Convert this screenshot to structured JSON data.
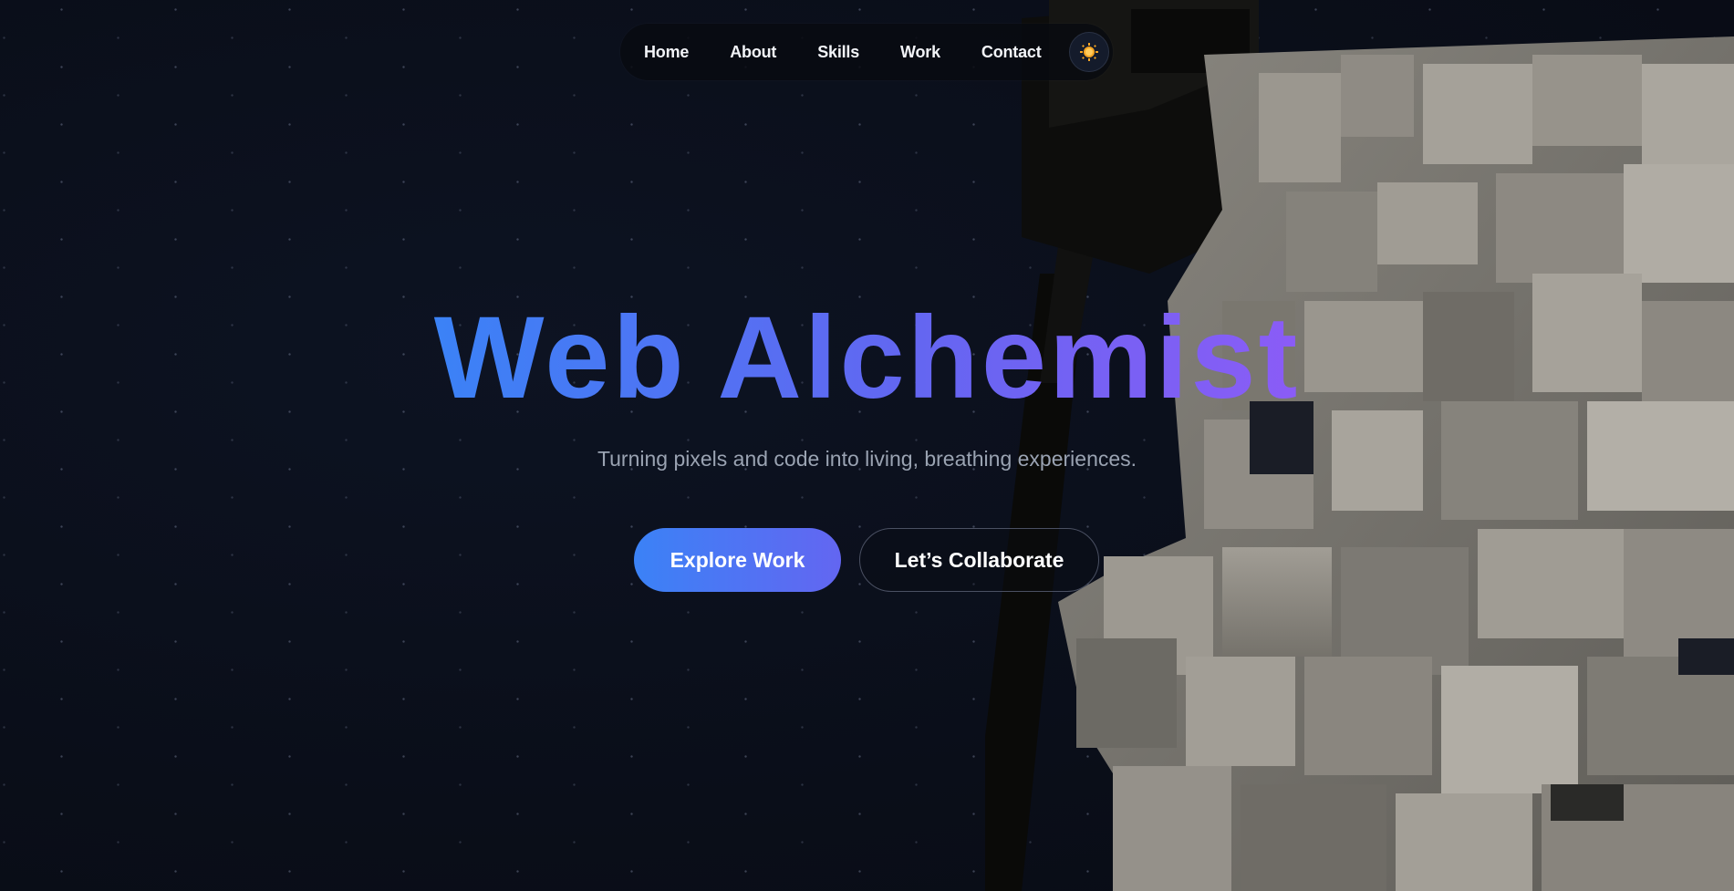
{
  "nav": {
    "items": [
      {
        "label": "Home"
      },
      {
        "label": "About"
      },
      {
        "label": "Skills"
      },
      {
        "label": "Work"
      },
      {
        "label": "Contact"
      }
    ],
    "theme_toggle_icon": "sun-icon"
  },
  "hero": {
    "title": "Web Alchemist",
    "subtitle": "Turning pixels and code into living, breathing experiences.",
    "primary_button": "Explore Work",
    "secondary_button": "Let’s Collaborate"
  },
  "colors": {
    "background": "#0b0f1a",
    "accent_start": "#3b82f6",
    "accent_end": "#8b5cf6",
    "sun": "#f5a524"
  }
}
